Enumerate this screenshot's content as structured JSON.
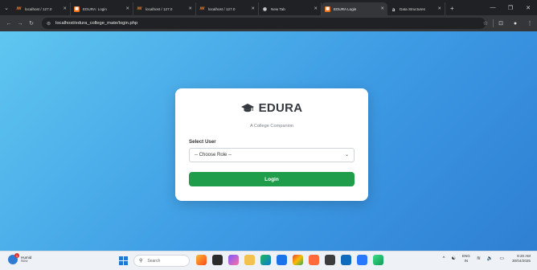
{
  "browser": {
    "tabs": [
      {
        "title": "localhost / 127.0",
        "icon": "xampp-icon",
        "active": false
      },
      {
        "title": "EDURA: Login",
        "icon": "edura-icon",
        "active": false
      },
      {
        "title": "localhost / 127.0",
        "icon": "xampp-icon",
        "active": false
      },
      {
        "title": "localhost / 127.0",
        "icon": "xampp-icon",
        "active": false
      },
      {
        "title": "New Tab",
        "icon": "chrome-icon",
        "active": false
      },
      {
        "title": "EDURA Login",
        "icon": "edura-icon",
        "active": true
      },
      {
        "title": "Data Structures",
        "icon": "page-icon",
        "active": false
      }
    ],
    "url": "localhost/edura_college_mate/login.php"
  },
  "login": {
    "brand": "EDURA",
    "subtitle": "A College Companion",
    "select_label": "Select User",
    "select_value": "-- Choose Role --",
    "button_label": "Login"
  },
  "taskbar": {
    "weather_line1": "Humid",
    "weather_line2": "Now",
    "search_placeholder": "Search",
    "lang_line1": "ENG",
    "lang_line2": "IN",
    "time": "9:20 AM",
    "date": "30/04/2025"
  },
  "colors": {
    "gradient_start": "#5fc6f0",
    "gradient_end": "#2f7fd3",
    "login_button": "#1f9d4b",
    "brand_text": "#343a40"
  }
}
